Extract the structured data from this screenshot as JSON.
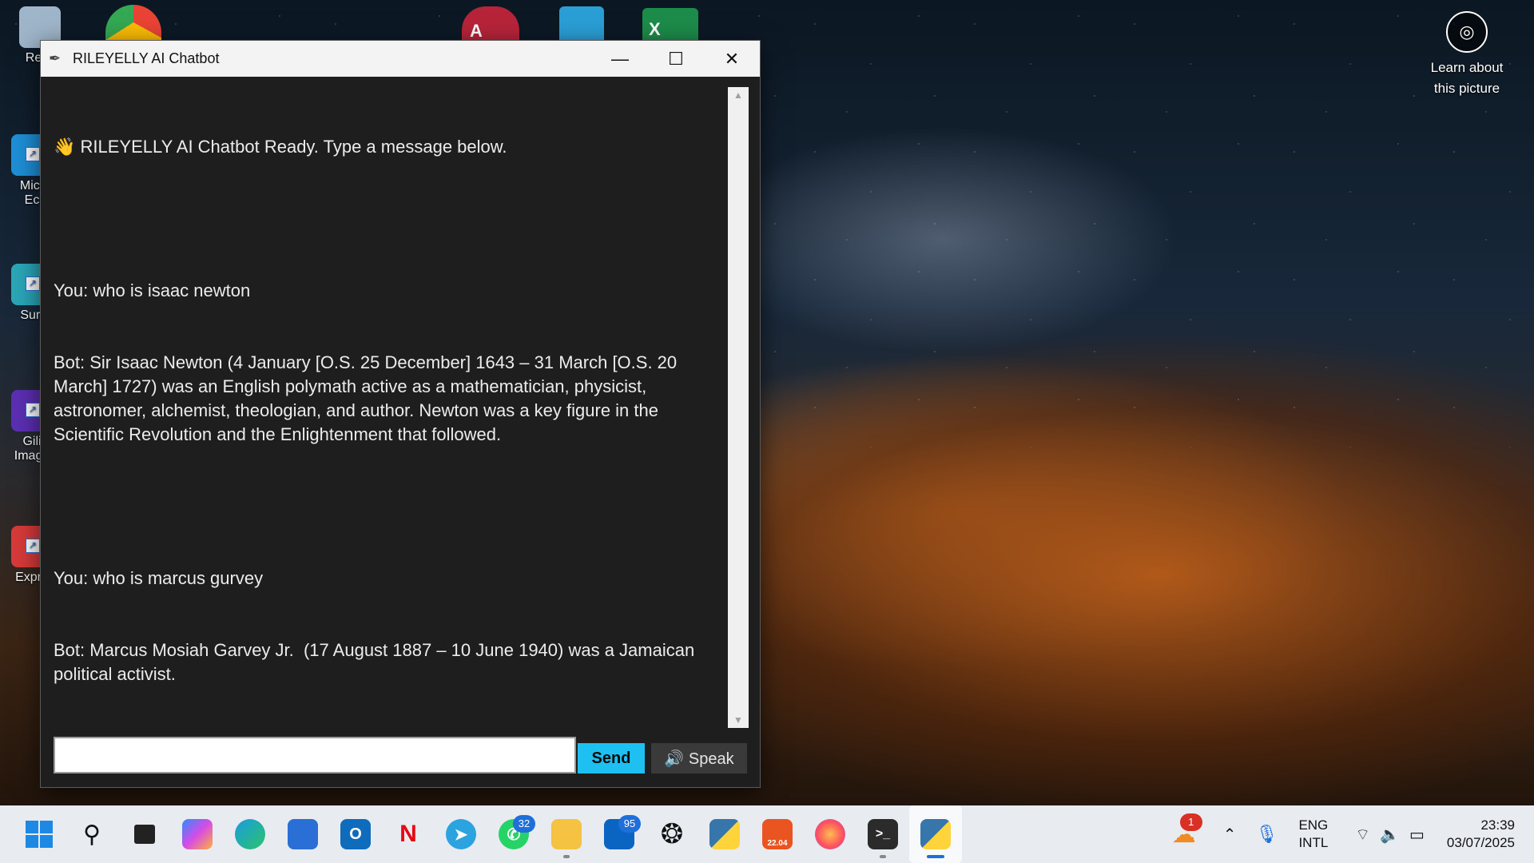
{
  "window": {
    "title": "RILEYELLY AI Chatbot",
    "controls": {
      "minimize": "—",
      "maximize": "☐",
      "close": "✕"
    }
  },
  "chat": {
    "lines": [
      "👋 RILEYELLY AI Chatbot Ready. Type a message below.",
      "",
      "You: who is isaac newton",
      "Bot: Sir Isaac Newton (4 January [O.S. 25 December] 1643 – 31 March [O.S. 20 March] 1727) was an English polymath active as a mathematician, physicist, astronomer, alchemist, theologian, and author. Newton was a key figure in the Scientific Revolution and the Enlightenment that followed.",
      "",
      "You: who is marcus gurvey",
      "Bot: Marcus Mosiah Garvey Jr.  (17 August 1887 – 10 June 1940) was a Jamaican political activist."
    ]
  },
  "input": {
    "value": "",
    "placeholder": ""
  },
  "buttons": {
    "send": "Send",
    "speak": "🔊 Speak"
  },
  "desktop": {
    "icons": [
      {
        "label": "Recy",
        "color": "#9fb5c9"
      },
      {
        "label": "Micr\nEc",
        "color": "#1e8fd6"
      },
      {
        "label": "Surf",
        "color": "#2aa7b8"
      },
      {
        "label": "Gili\nImage",
        "color": "#5b2fb3"
      },
      {
        "label": "Expre",
        "color": "#d83a3a"
      }
    ],
    "learn": {
      "label": "Learn about this picture"
    }
  },
  "taskbar": {
    "whatsapp_badge": "32",
    "outlook_badge": "95",
    "ubuntu_label": "22.04",
    "weather_badge": "1",
    "lang_top": "ENG",
    "lang_bottom": "INTL",
    "time": "23:39",
    "date": "03/07/2025"
  }
}
